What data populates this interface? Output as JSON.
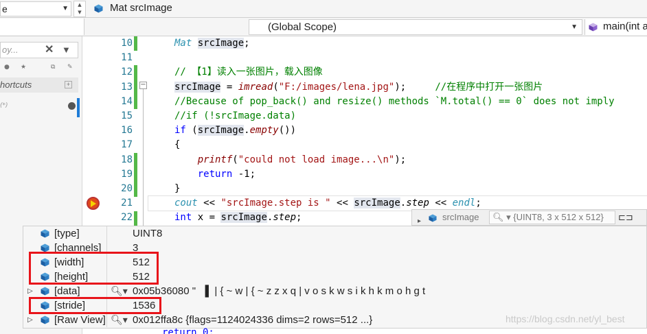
{
  "navbar": {
    "left_combo": "e",
    "title": "Mat srcImage"
  },
  "scopebar": {
    "scope": "(Global Scope)",
    "function": "main(int a"
  },
  "leftpanel": {
    "search_placeholder": "oy...",
    "section_title": "hortcuts",
    "item_text": "(*)"
  },
  "editor": {
    "line_numbers": [
      "10",
      "11",
      "12",
      "13",
      "14",
      "15",
      "16",
      "17",
      "18",
      "19",
      "20",
      "21",
      "22"
    ],
    "current_line": "21"
  },
  "datatip": {
    "name": "srcImage",
    "value": "{UINT8, 3 x 512 x 512}"
  },
  "watch": {
    "rows": [
      {
        "name": "[type]",
        "value": "UINT8"
      },
      {
        "name": "[channels]",
        "value": "3"
      },
      {
        "name": "[width]",
        "value": "512"
      },
      {
        "name": "[height]",
        "value": "512"
      },
      {
        "name": "[data]",
        "value": "0x05b36080 \"  ▐  | { ~ w | { ~ z z x q | v o s k w s i k h k m o h g t"
      },
      {
        "name": "[stride]",
        "value": "1536"
      },
      {
        "name": "[Raw View]",
        "value": "0x012ffa8c {flags=1124024336 dims=2 rows=512 ...}"
      }
    ]
  },
  "watermark": "https://blog.csdn.net/yl_best",
  "bottom_code": "return 0;",
  "colors": {
    "highlight_box": "#e8141a",
    "change_bar": "#54b848",
    "breakpoint": "#e04b1a",
    "keyword": "#0000ff"
  }
}
